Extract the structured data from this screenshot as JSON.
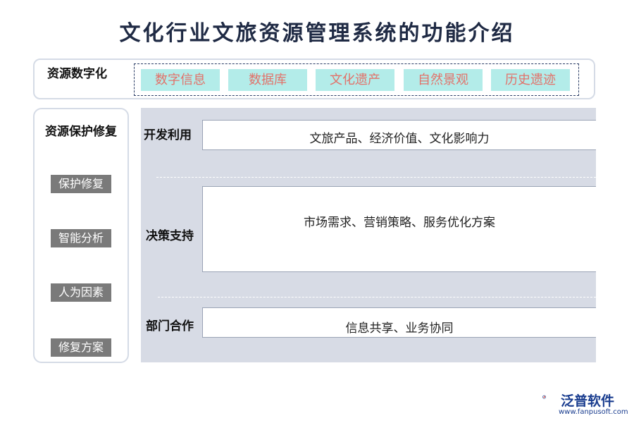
{
  "title": "文化行业文旅资源管理系统的功能介绍",
  "digital": {
    "label": "资源数字化",
    "chips": [
      "数字信息",
      "数据库",
      "文化遗产",
      "自然景观",
      "历史遗迹"
    ]
  },
  "protect": {
    "label": "资源保护修复",
    "items": [
      "保护修复",
      "智能分析",
      "人为因素",
      "修复方案"
    ]
  },
  "rows": [
    {
      "label": "开发利用",
      "content": "文旅产品、经济价值、文化影响力"
    },
    {
      "label": "决策支持",
      "content": "市场需求、营销策略、服务优化方案"
    },
    {
      "label": "部门合作",
      "content": "信息共享、业务协同"
    }
  ],
  "logo": {
    "name": "泛普软件",
    "url": "www.fanpusoft.com",
    "colors": {
      "primary": "#1a3d8f",
      "accent": "#e6402f"
    }
  },
  "colors": {
    "chip_bg": "#b3ece9",
    "chip_text": "#e2726a",
    "panel_bg": "#d7dbe5",
    "button_bg": "#7a7a7a"
  }
}
